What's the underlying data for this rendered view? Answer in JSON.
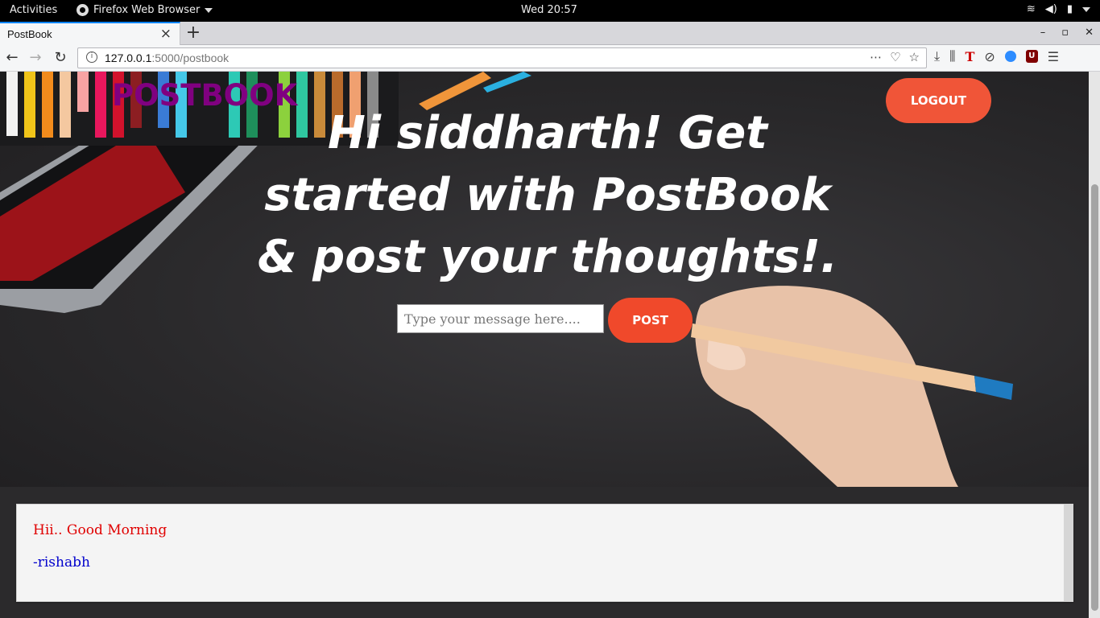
{
  "system_bar": {
    "activities": "Activities",
    "app_menu": "Firefox Web Browser",
    "clock": "Wed 20:57"
  },
  "browser": {
    "tab_title": "PostBook",
    "url_host": "127.0.0.1",
    "url_path": ":5000/postbook"
  },
  "page": {
    "brand": "POSTBOOK",
    "logout_label": "LOGOUT",
    "headline": "Hi siddharth! Get started with PostBook & post your thoughts!.",
    "message_placeholder": "Type your message here....",
    "post_label": "POST",
    "posts": [
      {
        "text": "Hii.. Good Morning",
        "author": "-rishabh"
      }
    ],
    "colors": {
      "brand": "#800080",
      "button": "#f05538",
      "post_text": "#e00000",
      "post_author": "#0000cc"
    }
  }
}
